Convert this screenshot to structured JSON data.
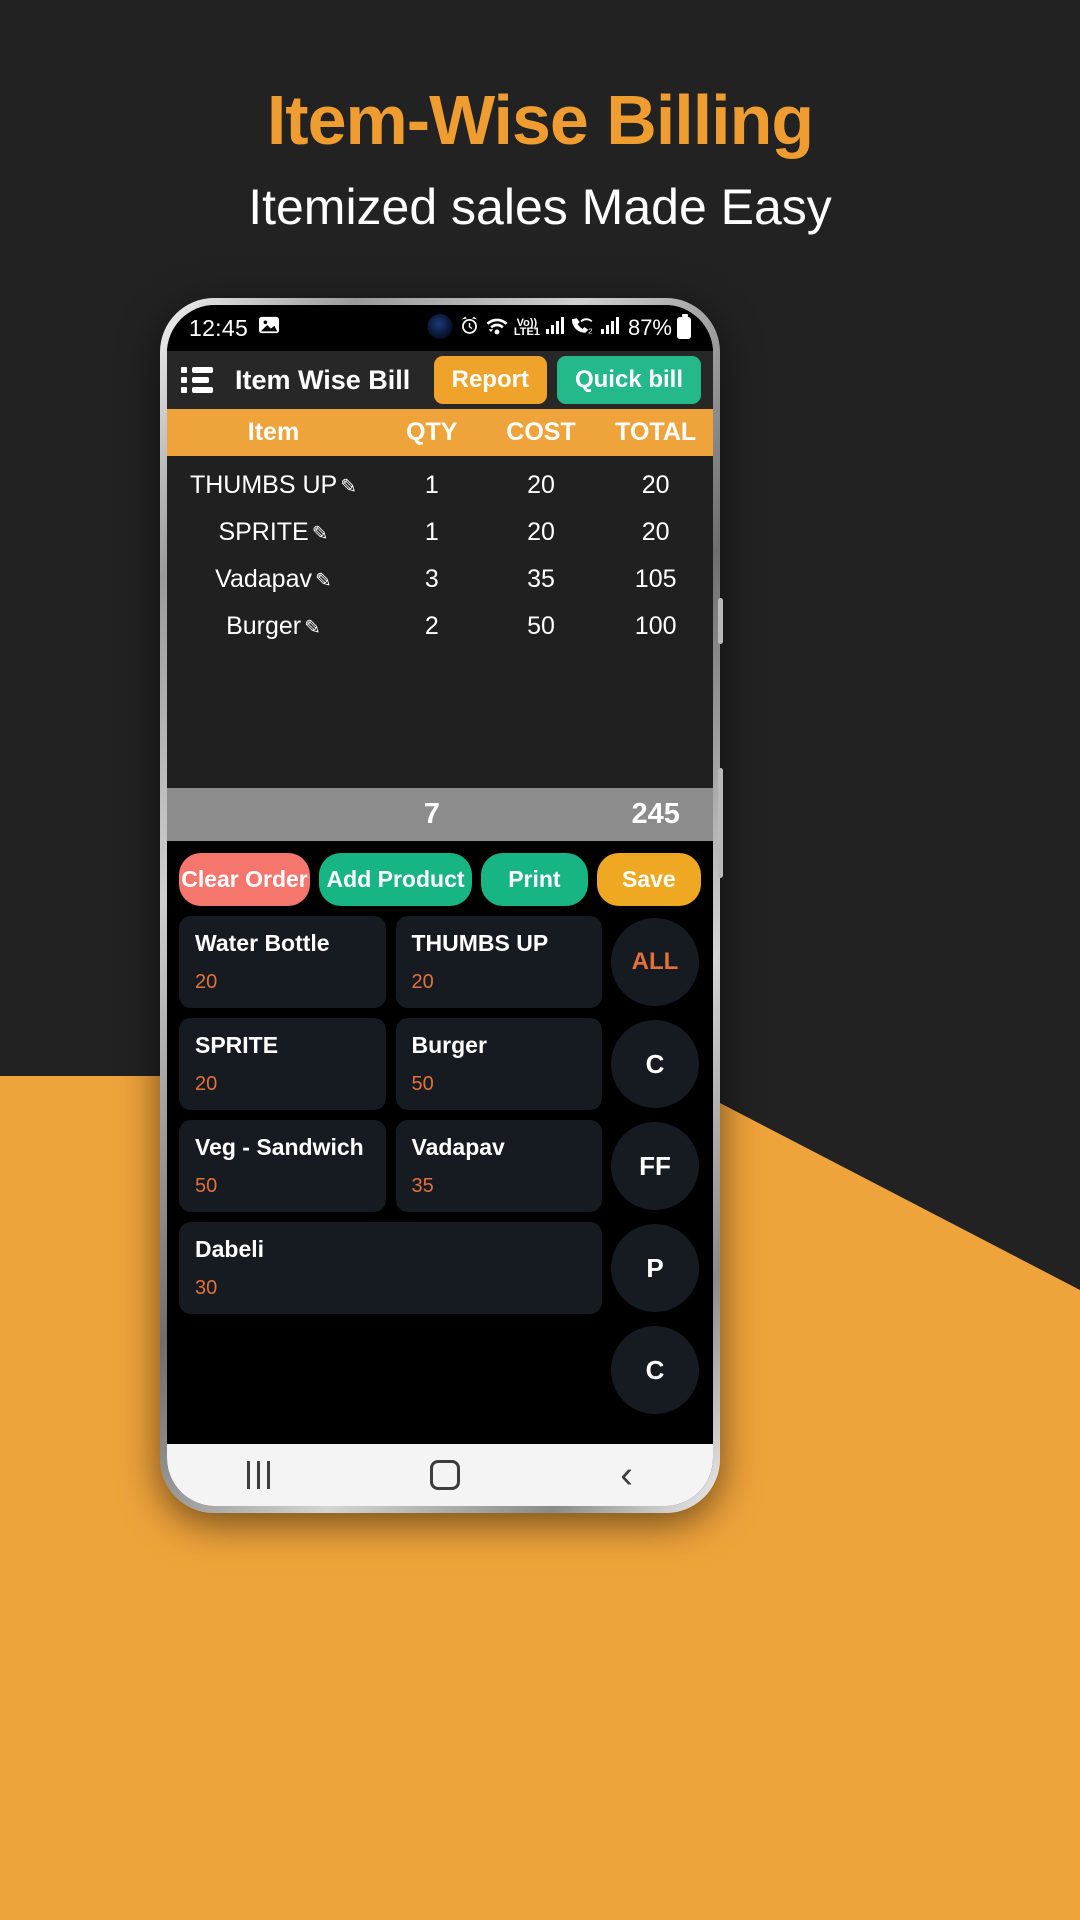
{
  "promo": {
    "title": "Item-Wise Billing",
    "subtitle": "Itemized sales Made Easy",
    "title_color": "#EF9C31",
    "background_color": "#222222",
    "accent_color": "#EFA33B"
  },
  "status_bar": {
    "time": "12:45",
    "image_icon": "image-icon",
    "alarm_icon": "alarm-icon",
    "wifi_icon": "wifi-icon",
    "volte_label": "Vo))",
    "network_label": "LTE1",
    "signal_icon": "signal-bars-icon",
    "call_icon": "call-wifi-icon",
    "sim2_label": "2",
    "signal2_icon": "signal-bars-icon",
    "battery_percent": "87%",
    "battery_icon": "battery-icon"
  },
  "app_bar": {
    "menu_icon": "list-menu-icon",
    "title": "Item Wise Bill",
    "report_label": "Report",
    "quick_bill_label": "Quick bill",
    "report_color": "#F0A32A",
    "quick_bill_color": "#23B98A"
  },
  "bill_table": {
    "headers": [
      "Item",
      "QTY",
      "COST",
      "TOTAL"
    ],
    "header_bg": "#EFA33B",
    "edit_icon": "pencil-icon",
    "rows": [
      {
        "item": "THUMBS UP",
        "qty": "1",
        "cost": "20",
        "total": "20"
      },
      {
        "item": "SPRITE",
        "qty": "1",
        "cost": "20",
        "total": "20"
      },
      {
        "item": "Vadapav",
        "qty": "3",
        "cost": "35",
        "total": "105"
      },
      {
        "item": "Burger",
        "qty": "2",
        "cost": "50",
        "total": "100"
      }
    ],
    "totals": {
      "qty": "7",
      "amount": "245",
      "bg": "#8C8C8C"
    }
  },
  "action_buttons": {
    "clear_order": "Clear Order",
    "add_product": "Add Product",
    "print": "Print",
    "save": "Save",
    "clear_color": "#F4766C",
    "add_color": "#17B583",
    "print_color": "#17B583",
    "save_color": "#EFA822"
  },
  "products": [
    {
      "name": "Water Bottle",
      "price": "20"
    },
    {
      "name": "THUMBS UP",
      "price": "20"
    },
    {
      "name": "SPRITE",
      "price": "20"
    },
    {
      "name": "Burger",
      "price": "50"
    },
    {
      "name": "Veg - Sandwich",
      "price": "50"
    },
    {
      "name": "Vadapav",
      "price": "35"
    },
    {
      "name": "Dabeli",
      "price": "30"
    }
  ],
  "categories": [
    {
      "label": "ALL",
      "selected": true
    },
    {
      "label": "C",
      "selected": false
    },
    {
      "label": "FF",
      "selected": false
    },
    {
      "label": "P",
      "selected": false
    },
    {
      "label": "C",
      "selected": false
    }
  ],
  "nav_bar": {
    "recents_icon": "recents-icon",
    "home_icon": "home-icon",
    "back_icon": "back-icon"
  }
}
